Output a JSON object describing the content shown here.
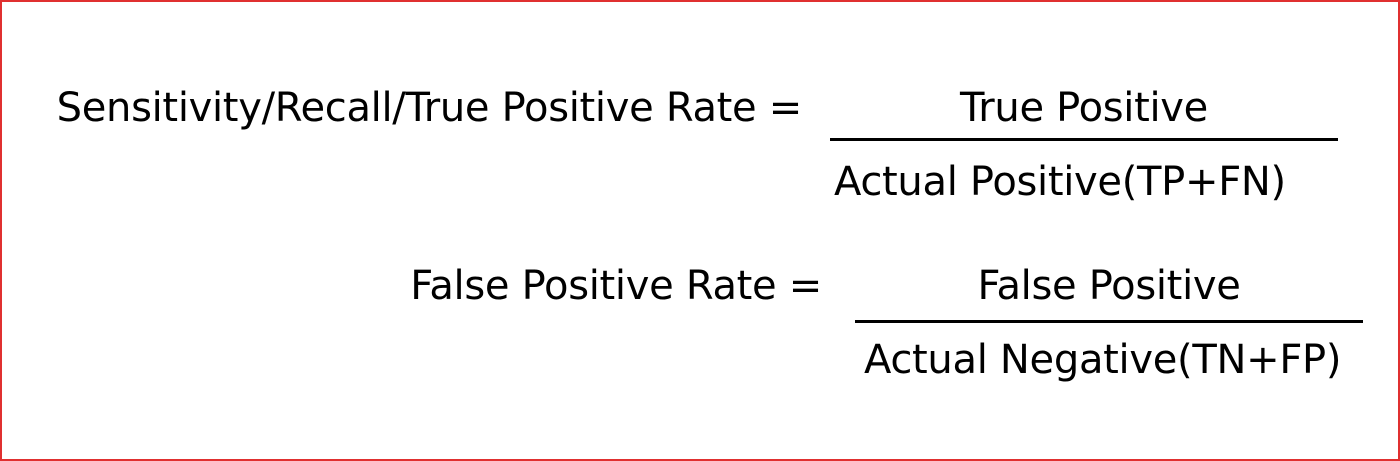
{
  "formulas": [
    {
      "lhs": "Sensitivity/Recall/True Positive Rate =",
      "numerator": "True Positive",
      "denominator": "Actual Positive(TP+FN)"
    },
    {
      "lhs": "False Positive Rate =",
      "numerator": "False Positive",
      "denominator": "Actual Negative(TN+FP)"
    }
  ],
  "colors": {
    "border": "#e03030",
    "text": "#000000",
    "background": "#ffffff"
  }
}
